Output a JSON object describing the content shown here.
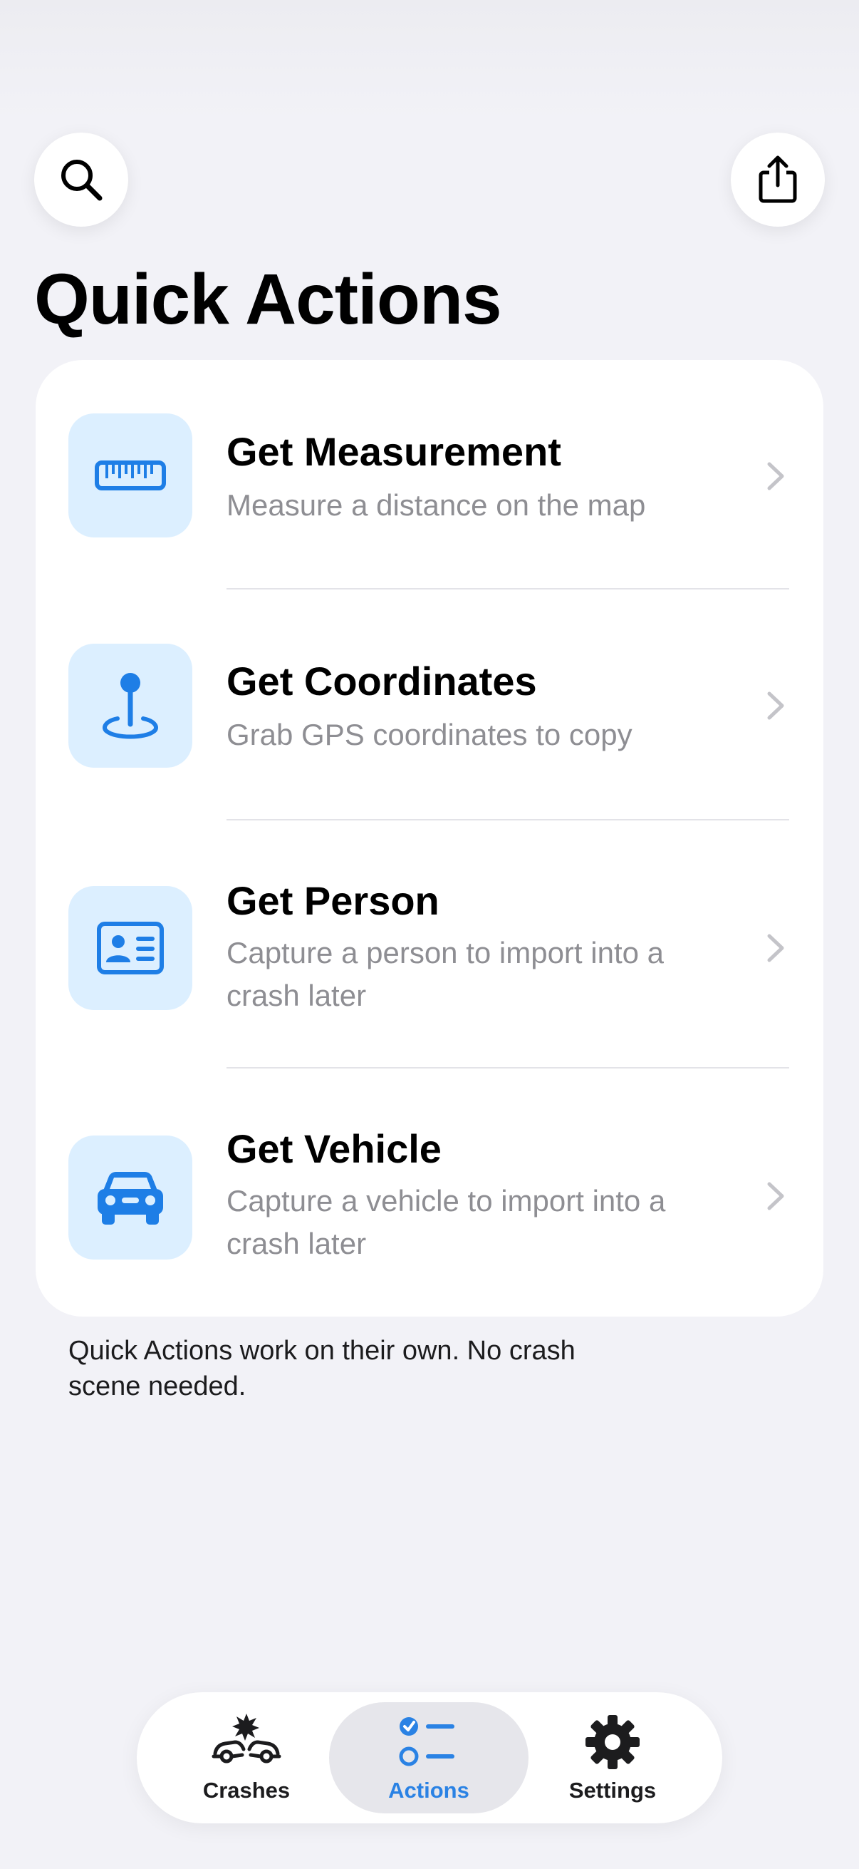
{
  "header": {
    "title": "Quick Actions",
    "search_icon": "magnifying-glass-icon",
    "share_icon": "share-icon"
  },
  "actions": [
    {
      "title": "Get Measurement",
      "subtitle": "Measure a distance on the map",
      "icon": "ruler-icon"
    },
    {
      "title": "Get Coordinates",
      "subtitle": "Grab GPS coordinates to copy",
      "icon": "map-pin-icon"
    },
    {
      "title": "Get Person",
      "subtitle": "Capture a person to import into a crash later",
      "icon": "id-card-icon"
    },
    {
      "title": "Get Vehicle",
      "subtitle": "Capture a vehicle to import into a crash later",
      "icon": "car-icon"
    }
  ],
  "footer_note": "Quick Actions work on their own. No crash scene needed.",
  "tabbar": {
    "tabs": [
      {
        "label": "Crashes",
        "icon": "car-crash-icon",
        "active": false
      },
      {
        "label": "Actions",
        "icon": "checklist-icon",
        "active": true
      },
      {
        "label": "Settings",
        "icon": "gear-icon",
        "active": false
      }
    ]
  },
  "colors": {
    "background": "#f2f2f7",
    "card": "#ffffff",
    "accent": "#2a82e4",
    "icon_tile": "#dcefff",
    "subtitle": "#8e8e93"
  }
}
